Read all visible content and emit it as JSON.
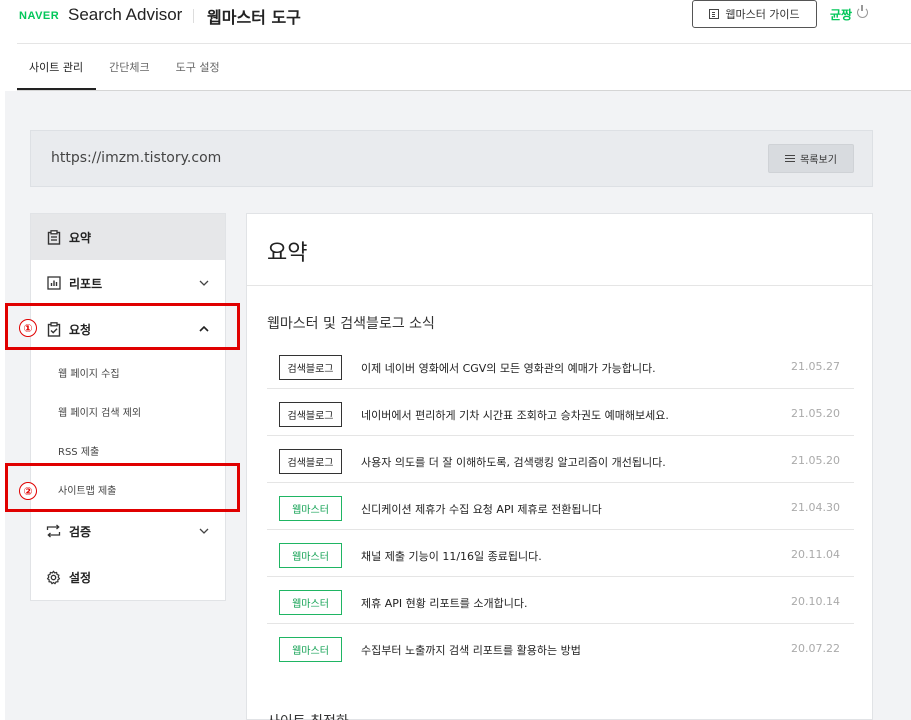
{
  "header": {
    "logo": "NAVER",
    "brand": "Search Advisor",
    "tool_title": "웹마스터 도구",
    "guide_button": "웹마스터 가이드",
    "user_name": "균짱"
  },
  "tabs": [
    {
      "label": "사이트 관리"
    },
    {
      "label": "간단체크"
    },
    {
      "label": "도구 설정"
    }
  ],
  "site": {
    "url": "https://imzm.tistory.com",
    "list_button": "목록보기"
  },
  "sidebar": {
    "items": [
      {
        "label": "요약",
        "icon": "clipboard-icon"
      },
      {
        "label": "리포트",
        "icon": "bar-chart-icon"
      },
      {
        "label": "요청",
        "icon": "check-clipboard-icon"
      },
      {
        "label": "검증",
        "icon": "swap-icon"
      },
      {
        "label": "설정",
        "icon": "gear-icon"
      }
    ],
    "sub_items": [
      {
        "label": "웹 페이지 수집"
      },
      {
        "label": "웹 페이지 검색 제외"
      },
      {
        "label": "RSS 제출"
      },
      {
        "label": "사이트맵 제출"
      }
    ]
  },
  "annotations": {
    "marker1": "①",
    "marker2": "②"
  },
  "main": {
    "title": "요약",
    "section_title": "웹마스터 및 검색블로그 소식",
    "news": [
      {
        "tag": "검색블로그",
        "text": "이제 네이버 영화에서 CGV의 모든 영화관의 예매가 가능합니다.",
        "date": "21.05.27"
      },
      {
        "tag": "검색블로그",
        "text": "네이버에서 편리하게 기차 시간표 조회하고 승차권도 예매해보세요.",
        "date": "21.05.20"
      },
      {
        "tag": "검색블로그",
        "text": "사용자 의도를 더 잘 이해하도록, 검색랭킹 알고리즘이 개선됩니다.",
        "date": "21.05.20"
      },
      {
        "tag": "웹마스터",
        "text": "신디케이션 제휴가 수집 요청 API 제휴로 전환됩니다",
        "date": "21.04.30"
      },
      {
        "tag": "웹마스터",
        "text": "채널 제출 기능이 11/16일 종료됩니다.",
        "date": "20.11.04"
      },
      {
        "tag": "웹마스터",
        "text": "제휴 API 현황 리포트를 소개합니다.",
        "date": "20.10.14"
      },
      {
        "tag": "웹마스터",
        "text": "수집부터 노출까지 검색 리포트를 활용하는 방법",
        "date": "20.07.22"
      }
    ],
    "next_section": "사이트 최적화"
  },
  "colors": {
    "accent_green": "#03c75a",
    "highlight_red": "#e00000"
  }
}
